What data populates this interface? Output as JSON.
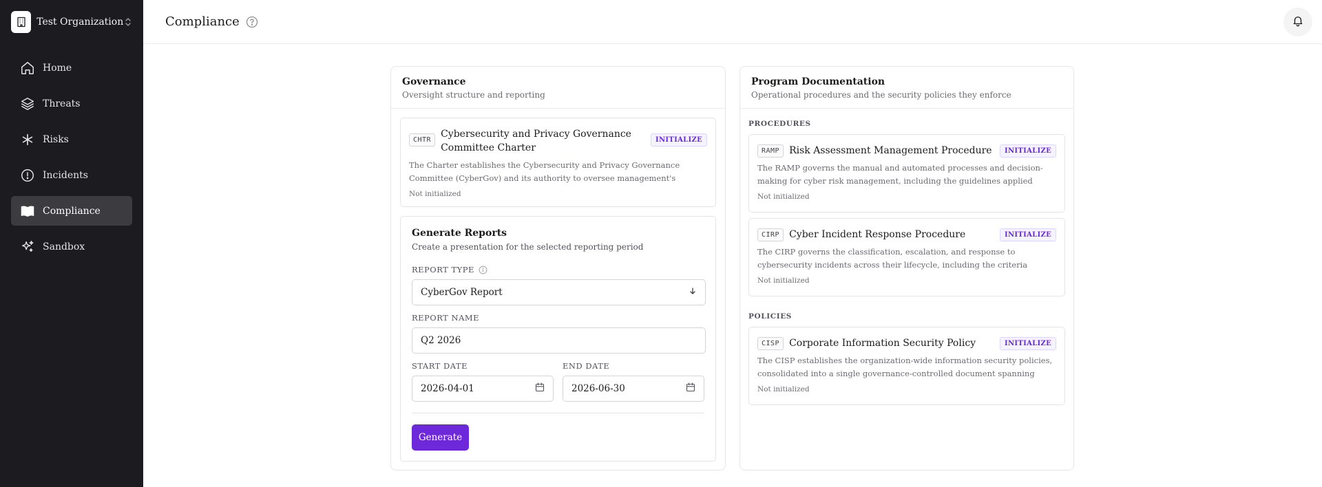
{
  "sidebar": {
    "org_name": "Test Organization",
    "items": [
      {
        "label": "Home",
        "icon": "home-icon"
      },
      {
        "label": "Threats",
        "icon": "layers-icon"
      },
      {
        "label": "Risks",
        "icon": "asterisk-icon"
      },
      {
        "label": "Incidents",
        "icon": "alert-circle-icon"
      },
      {
        "label": "Compliance",
        "icon": "book-open-icon",
        "active": true
      },
      {
        "label": "Sandbox",
        "icon": "sparkles-icon"
      }
    ]
  },
  "header": {
    "title": "Compliance"
  },
  "governance": {
    "title": "Governance",
    "subtitle": "Oversight structure and reporting",
    "docs": [
      {
        "code": "CHTR",
        "title": "Cybersecurity and Privacy Governance Committee Charter",
        "description": "The Charter establishes the Cybersecurity and Privacy Governance Committee (CyberGov) and its authority to oversee management's implementation of the…",
        "status": "Not initialized",
        "action": "INITIALIZE"
      }
    ]
  },
  "reports": {
    "title": "Generate Reports",
    "subtitle": "Create a presentation for the selected reporting period",
    "report_type_label": "REPORT TYPE",
    "report_type_value": "CyberGov Report",
    "report_name_label": "REPORT NAME",
    "report_name_value": "Q2 2026",
    "start_date_label": "START DATE",
    "start_date_value": "2026-04-01",
    "end_date_label": "END DATE",
    "end_date_value": "2026-06-30",
    "generate_label": "Generate"
  },
  "program": {
    "title": "Program Documentation",
    "subtitle": "Operational procedures and the security policies they enforce",
    "procedures_label": "PROCEDURES",
    "policies_label": "POLICIES",
    "procedures": [
      {
        "code": "RAMP",
        "title": "Risk Assessment Management Procedure",
        "description": "The RAMP governs the manual and automated processes and decision-making for cyber risk management, including the guidelines applied when AI or analysts…",
        "status": "Not initialized",
        "action": "INITIALIZE"
      },
      {
        "code": "CIRP",
        "title": "Cyber Incident Response Procedure",
        "description": "The CIRP governs the classification, escalation, and response to cybersecurity incidents across their lifecycle, including the criteria applied to every automated a…",
        "status": "Not initialized",
        "action": "INITIALIZE"
      }
    ],
    "policies": [
      {
        "code": "CISP",
        "title": "Corporate Information Security Policy",
        "description": "The CISP establishes the organization-wide information security policies, consolidated into a single governance-controlled document spanning acceptable u…",
        "status": "Not initialized",
        "action": "INITIALIZE"
      }
    ]
  },
  "colors": {
    "sidebar_bg": "#1c1b1f",
    "accent": "#6d28d9"
  }
}
